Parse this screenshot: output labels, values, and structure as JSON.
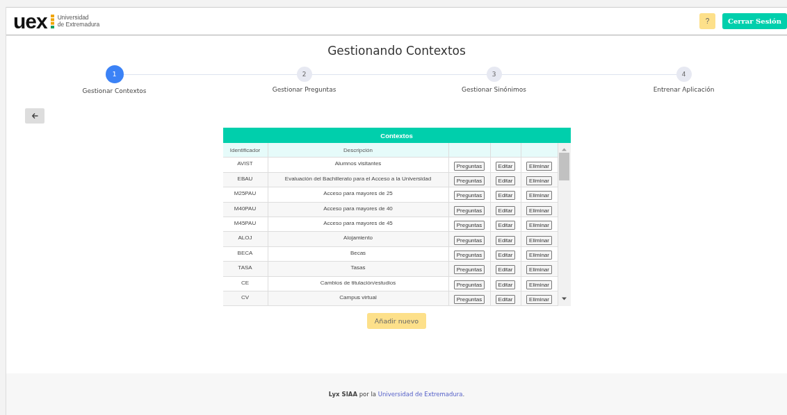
{
  "header": {
    "logo": {
      "mark": "uex",
      "line_1": "Universidad",
      "line_2": "de Extremadura"
    },
    "help_button": "?",
    "logout_button": "Cerrar Sesión"
  },
  "title": "Gestionando Contextos",
  "steps": [
    {
      "number": "1",
      "label": "Gestionar Contextos",
      "selected": true
    },
    {
      "number": "2",
      "label": "Gestionar Preguntas",
      "selected": false
    },
    {
      "number": "3",
      "label": "Gestionar Sinónimos",
      "selected": false
    },
    {
      "number": "4",
      "label": "Entrenar Aplicación",
      "selected": false
    }
  ],
  "table": {
    "title": "Contextos",
    "columns": [
      "Identificador",
      "Descripción"
    ],
    "rows": [
      {
        "id": "AVIST",
        "description": "Alumnos visitantes",
        "actions": [
          "Preguntas",
          "Editar",
          "Eliminar"
        ]
      },
      {
        "id": "EBAU",
        "description": "Evaluación del Bachillerato para el Acceso a la Universidad",
        "actions": [
          "Preguntas",
          "Editar",
          "Eliminar"
        ]
      },
      {
        "id": "M25PAU",
        "description": "Acceso para mayores de 25",
        "actions": [
          "Preguntas",
          "Editar",
          "Eliminar"
        ]
      },
      {
        "id": "M40PAU",
        "description": "Acceso para mayores de 40",
        "actions": [
          "Preguntas",
          "Editar",
          "Eliminar"
        ]
      },
      {
        "id": "M45PAU",
        "description": "Acceso para mayores de 45",
        "actions": [
          "Preguntas",
          "Editar",
          "Eliminar"
        ]
      },
      {
        "id": "ALOJ",
        "description": "Alojamiento",
        "actions": [
          "Preguntas",
          "Editar",
          "Eliminar"
        ]
      },
      {
        "id": "BECA",
        "description": "Becas",
        "actions": [
          "Preguntas",
          "Editar",
          "Eliminar"
        ]
      },
      {
        "id": "TASA",
        "description": "Tasas",
        "actions": [
          "Preguntas",
          "Editar",
          "Eliminar"
        ]
      },
      {
        "id": "CE",
        "description": "Cambios de titulación/estudios",
        "actions": [
          "Preguntas",
          "Editar",
          "Eliminar"
        ]
      },
      {
        "id": "CV",
        "description": "Campus virtual",
        "actions": [
          "Preguntas",
          "Editar",
          "Eliminar"
        ]
      }
    ]
  },
  "add_button": "Añadir nuevo",
  "footer": {
    "text": "**Lyx SIAA** por la",
    "link": "Universidad de Extremadura",
    "end": "."
  }
}
